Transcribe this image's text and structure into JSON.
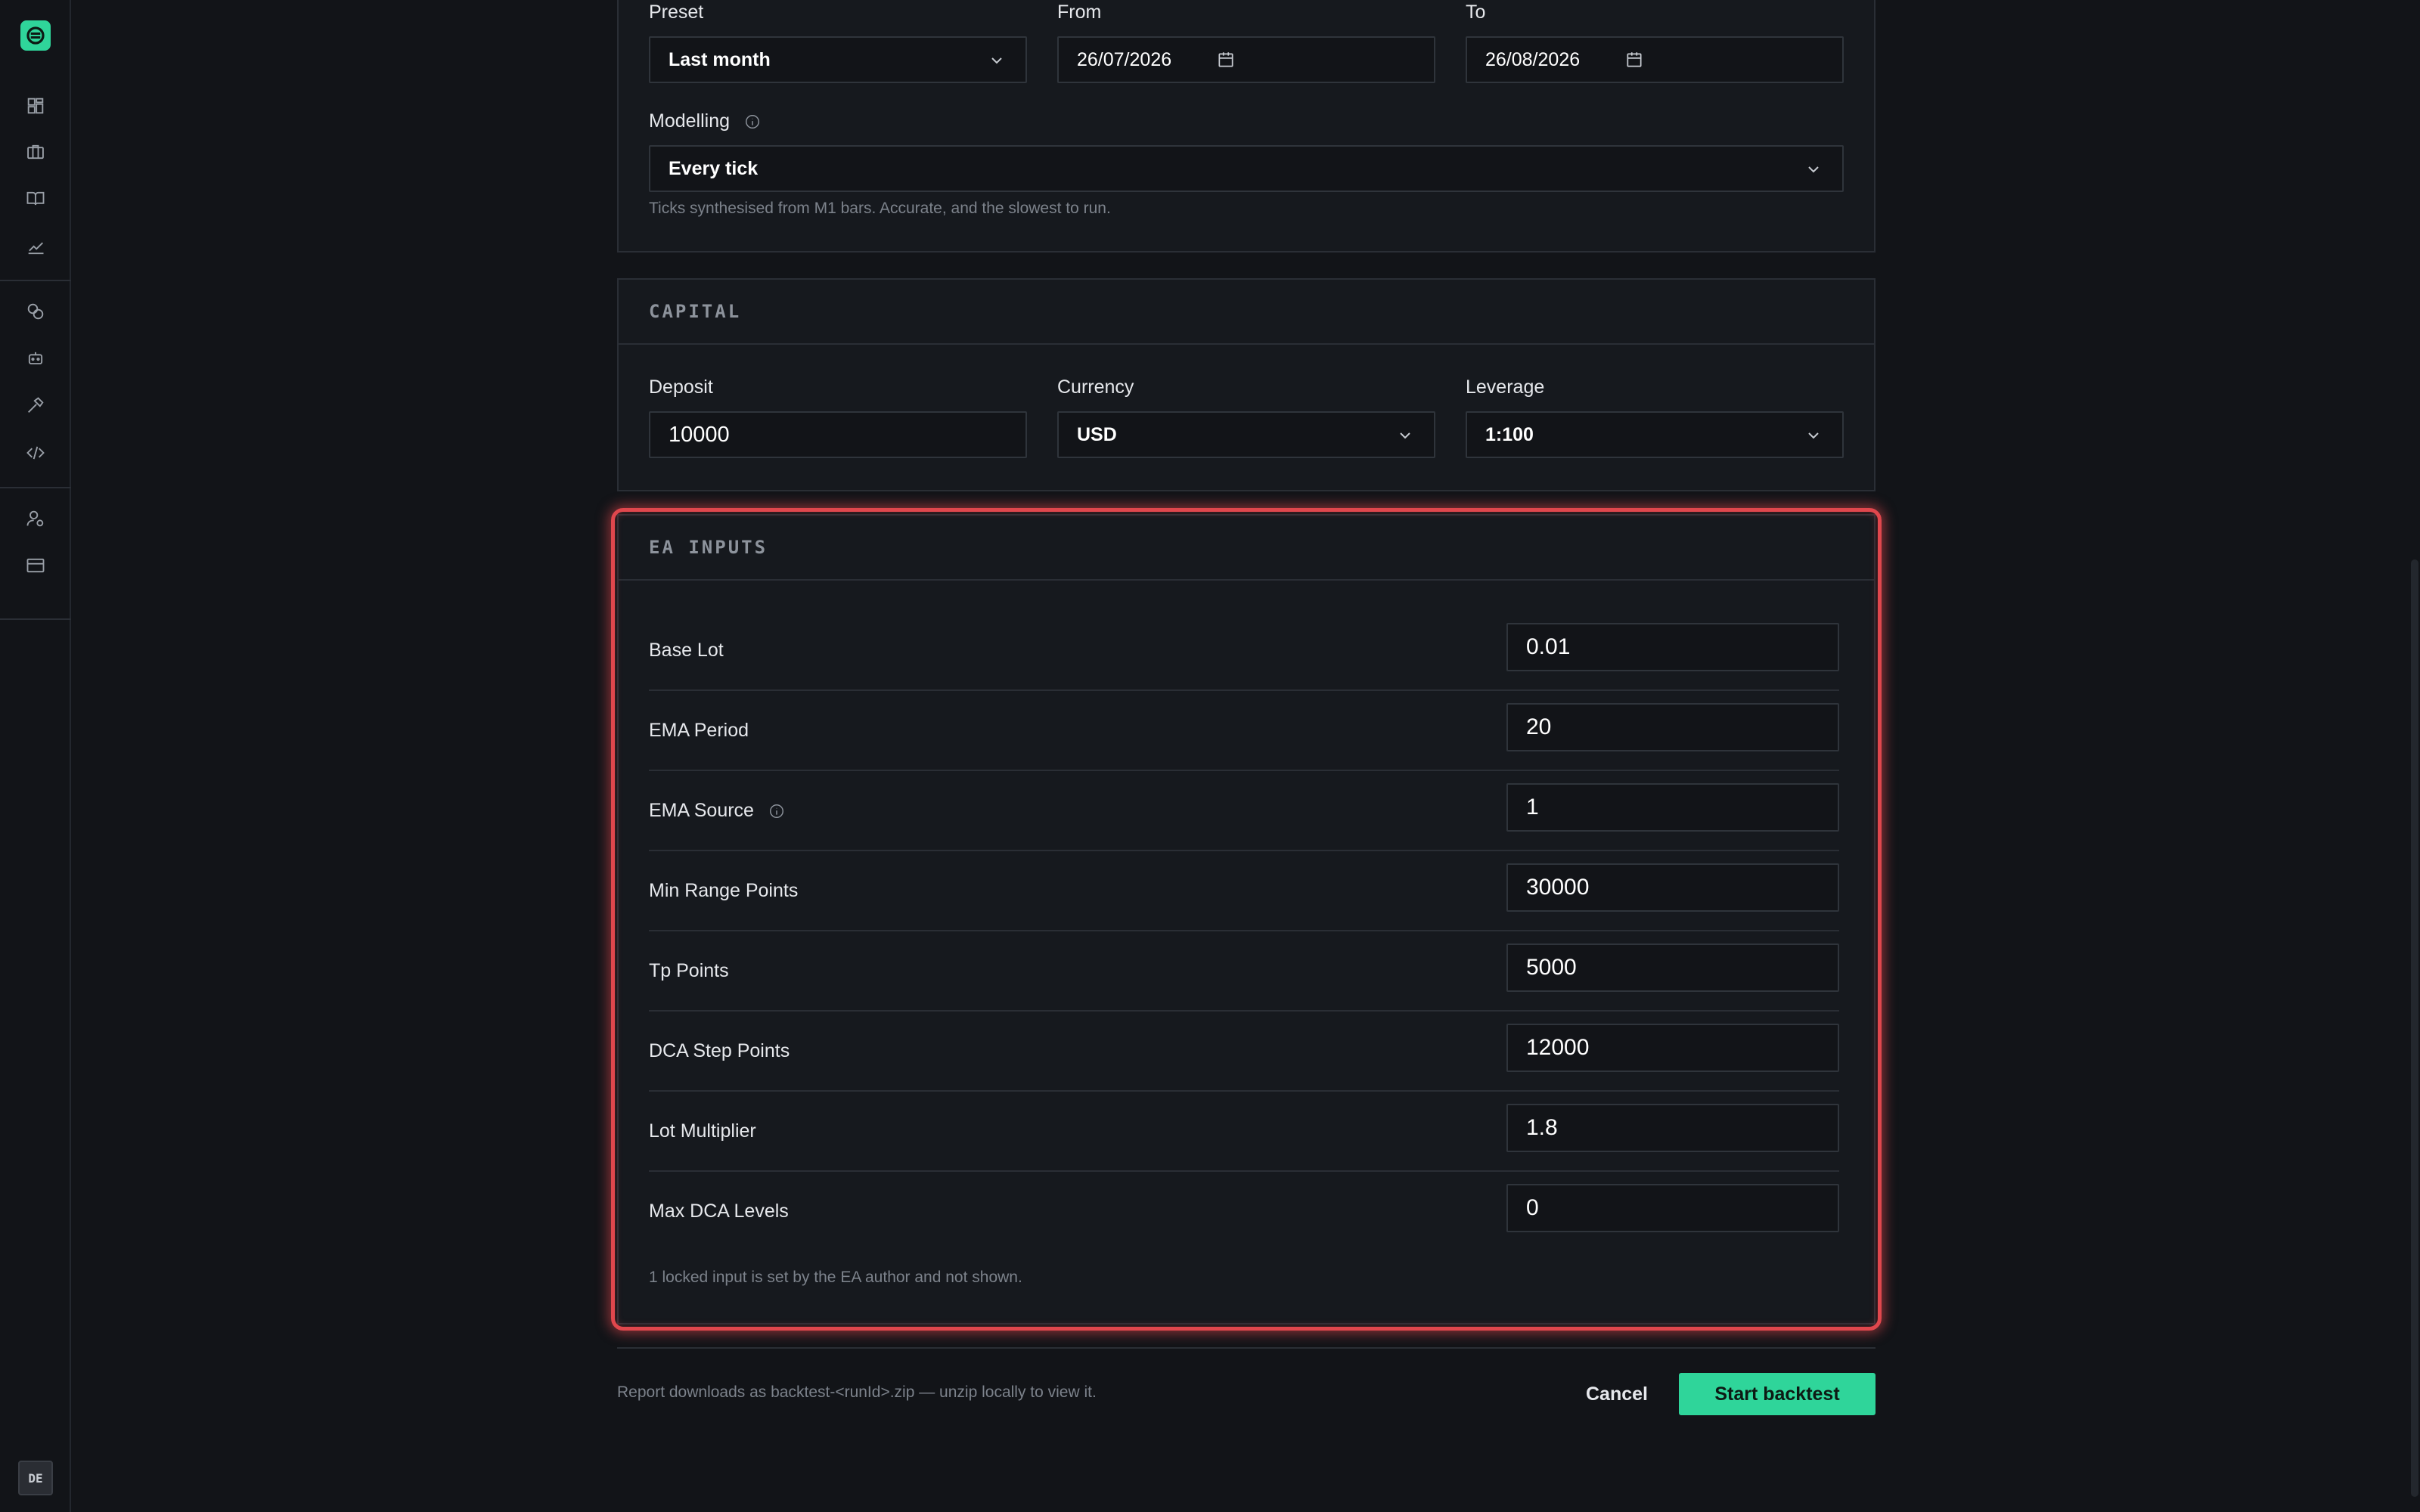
{
  "colors": {
    "accent": "#2fd59a",
    "highlight": "#e0474d",
    "background": "#121418",
    "panel": "#16191e"
  },
  "sidebar": {
    "icons": [
      "dashboard-icon",
      "briefcase-icon",
      "book-icon",
      "chart-line-icon",
      "coins-icon",
      "robot-icon",
      "hammer-icon",
      "code-icon",
      "user-settings-icon",
      "billing-icon"
    ],
    "language": "DE"
  },
  "period": {
    "preset_label": "Preset",
    "preset_value": "Last month",
    "from_label": "From",
    "from_value": "26/07/2026",
    "to_label": "To",
    "to_value": "26/08/2026",
    "modelling_label": "Modelling",
    "modelling_value": "Every tick",
    "modelling_hint": "Ticks synthesised from M1 bars. Accurate, and the slowest to run."
  },
  "capital": {
    "title": "CAPITAL",
    "deposit_label": "Deposit",
    "deposit_value": "10000",
    "currency_label": "Currency",
    "currency_value": "USD",
    "leverage_label": "Leverage",
    "leverage_value": "1:100"
  },
  "ea_inputs": {
    "title": "EA INPUTS",
    "rows": [
      {
        "label": "Base Lot",
        "value": "0.01"
      },
      {
        "label": "EMA Period",
        "value": "20"
      },
      {
        "label": "EMA Source",
        "value": "1"
      },
      {
        "label": "Min Range Points",
        "value": "30000"
      },
      {
        "label": "Tp Points",
        "value": "5000"
      },
      {
        "label": "DCA Step Points",
        "value": "12000"
      },
      {
        "label": "Lot Multiplier",
        "value": "1.8"
      },
      {
        "label": "Max DCA Levels",
        "value": "0"
      }
    ],
    "note": "1 locked input is set by the EA author and not shown."
  },
  "footer": {
    "note": "Report downloads as backtest-<runId>.zip — unzip locally to view it.",
    "cancel_label": "Cancel",
    "start_label": "Start backtest"
  }
}
